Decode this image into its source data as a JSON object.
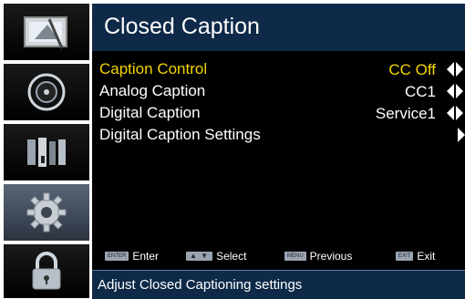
{
  "header": {
    "title": "Closed Caption"
  },
  "menu": {
    "items": [
      {
        "label": "Caption Control",
        "value": "CC Off"
      },
      {
        "label": "Analog Caption",
        "value": "CC1"
      },
      {
        "label": "Digital Caption",
        "value": "Service1"
      },
      {
        "label": "Digital Caption Settings",
        "value": ""
      }
    ],
    "selected_index": 0
  },
  "sidebar": {
    "items": [
      {
        "icon": "picture-icon"
      },
      {
        "icon": "audio-disc-icon"
      },
      {
        "icon": "channel-icon"
      },
      {
        "icon": "settings-gear-icon",
        "selected": true
      },
      {
        "icon": "lock-icon"
      }
    ]
  },
  "footer": {
    "enter": {
      "key": "ENTER",
      "label": "Enter"
    },
    "select": {
      "key": "▲ ▼",
      "label": "Select"
    },
    "previous": {
      "key": "MENU",
      "label": "Previous"
    },
    "exit": {
      "key": "EXIT",
      "label": "Exit"
    }
  },
  "status": {
    "text": "Adjust Closed Captioning settings"
  },
  "colors": {
    "title_bar": "#0e2a48",
    "selected_text": "#f4d400",
    "panel_bg": "#000000",
    "text": "#ffffff"
  }
}
